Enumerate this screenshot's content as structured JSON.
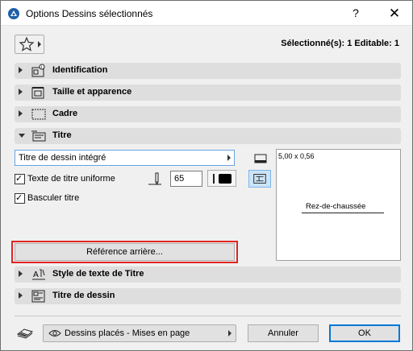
{
  "window": {
    "title": "Options Dessins sélectionnés",
    "help": "?",
    "close": "✕"
  },
  "header": {
    "selected_info": "Sélectionné(s): 1 Editable: 1"
  },
  "sections": [
    {
      "label": "Identification",
      "icon": "id-icon",
      "expanded": false
    },
    {
      "label": "Taille et apparence",
      "icon": "size-icon",
      "expanded": false
    },
    {
      "label": "Cadre",
      "icon": "frame-icon",
      "expanded": false
    },
    {
      "label": "Titre",
      "icon": "title-icon",
      "expanded": true
    },
    {
      "label": "Style de texte de Titre",
      "icon": "text-style-icon",
      "expanded": false
    },
    {
      "label": "Titre de dessin",
      "icon": "drawing-title-icon",
      "expanded": false
    }
  ],
  "titre": {
    "type_value": "Titre de dessin intégré",
    "uniform_label": "Texte de titre uniforme",
    "uniform_checked": true,
    "pen_value": "65",
    "flip_label": "Basculer titre",
    "flip_checked": true,
    "reference_button": "Référence arrière..."
  },
  "preview": {
    "scale": "5,00 x 0,56",
    "title_text": "Rez-de-chaussée"
  },
  "footer": {
    "layer_dropdown": "Dessins placés - Mises en page",
    "cancel": "Annuler",
    "ok": "OK"
  },
  "colors": {
    "accent": "#0078d7",
    "highlight": "#e02424",
    "section_bg": "#dedede"
  }
}
